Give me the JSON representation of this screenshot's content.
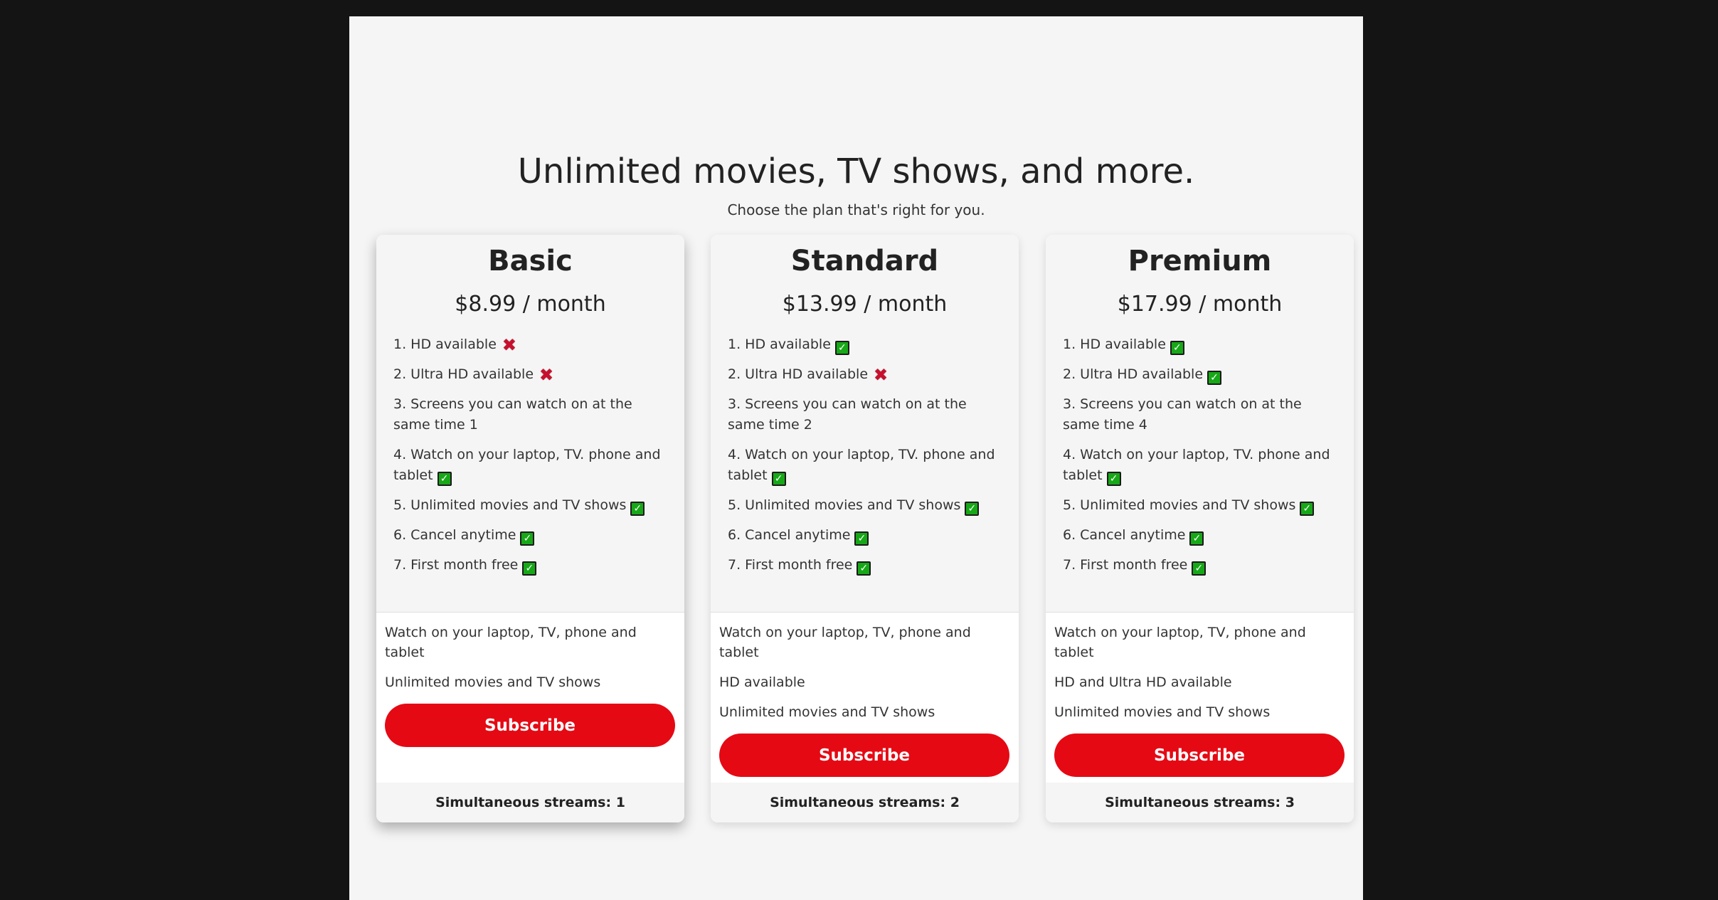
{
  "header": {
    "title": "Unlimited movies, TV shows, and more.",
    "subtitle": "Choose the plan that's right for you."
  },
  "colors": {
    "page_bg": "#141414",
    "panel_bg": "#f5f5f5",
    "brand_red": "#e50914",
    "check_green": "#17a817",
    "cross_red": "#c8102e"
  },
  "plans": [
    {
      "name": "Basic",
      "price": "$8.99 / month",
      "features": [
        {
          "text": "1. HD available",
          "icon": "cross-icon"
        },
        {
          "text": "2. Ultra HD available",
          "icon": "cross-icon"
        },
        {
          "text": "3. Screens you can watch on at the same time 1",
          "icon": ""
        },
        {
          "text": "4. Watch on your laptop, TV. phone and tablet",
          "icon": "check-icon"
        },
        {
          "text": "5. Unlimited movies and TV shows",
          "icon": "check-icon"
        },
        {
          "text": "6. Cancel anytime",
          "icon": "check-icon"
        },
        {
          "text": "7. First month free",
          "icon": "check-icon"
        }
      ],
      "perks": [
        "Watch on your laptop, TV, phone and tablet",
        "Unlimited movies and TV shows"
      ],
      "button": "Subscribe",
      "footer": "Simultaneous streams: 1"
    },
    {
      "name": "Standard",
      "price": "$13.99 / month",
      "features": [
        {
          "text": "1. HD available",
          "icon": "check-icon"
        },
        {
          "text": "2. Ultra HD available",
          "icon": "cross-icon"
        },
        {
          "text": "3. Screens you can watch on at the same time 2",
          "icon": ""
        },
        {
          "text": "4. Watch on your laptop, TV. phone and tablet",
          "icon": "check-icon"
        },
        {
          "text": "5. Unlimited movies and TV shows",
          "icon": "check-icon"
        },
        {
          "text": "6. Cancel anytime",
          "icon": "check-icon"
        },
        {
          "text": "7. First month free",
          "icon": "check-icon"
        }
      ],
      "perks": [
        "Watch on your laptop, TV, phone and tablet",
        "HD available",
        "Unlimited movies and TV shows"
      ],
      "button": "Subscribe",
      "footer": "Simultaneous streams: 2"
    },
    {
      "name": "Premium",
      "price": "$17.99 / month",
      "features": [
        {
          "text": "1. HD available",
          "icon": "check-icon"
        },
        {
          "text": "2. Ultra HD available",
          "icon": "check-icon"
        },
        {
          "text": "3. Screens you can watch on at the same time 4",
          "icon": ""
        },
        {
          "text": "4. Watch on your laptop, TV. phone and tablet",
          "icon": "check-icon"
        },
        {
          "text": "5. Unlimited movies and TV shows",
          "icon": "check-icon"
        },
        {
          "text": "6. Cancel anytime",
          "icon": "check-icon"
        },
        {
          "text": "7. First month free",
          "icon": "check-icon"
        }
      ],
      "perks": [
        "Watch on your laptop, TV, phone and tablet",
        "HD and Ultra HD available",
        "Unlimited movies and TV shows"
      ],
      "button": "Subscribe",
      "footer": "Simultaneous streams: 3"
    }
  ]
}
